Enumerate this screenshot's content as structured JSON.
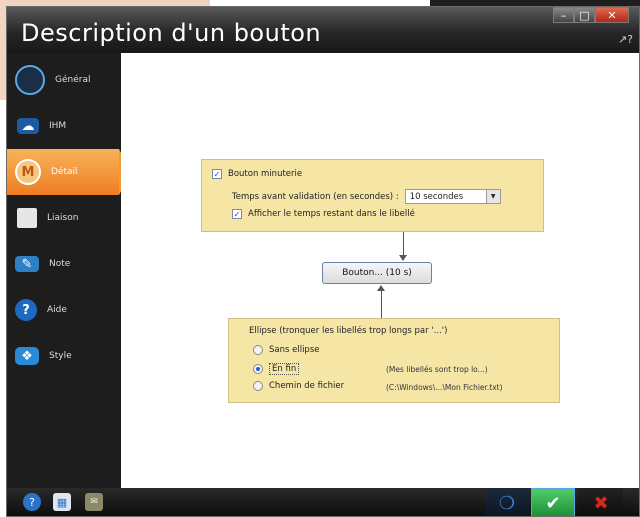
{
  "window": {
    "title": "Description d'un bouton",
    "controls": [
      "minimize-icon",
      "maximize-icon",
      "close-icon"
    ]
  },
  "sidebar": {
    "items": [
      {
        "label": "Général",
        "icon": "general-icon",
        "active": false
      },
      {
        "label": "IHM",
        "icon": "ihm-icon",
        "active": false
      },
      {
        "label": "Détail",
        "icon": "detail-icon",
        "active": true
      },
      {
        "label": "Liaison",
        "icon": "liaison-icon",
        "active": false
      },
      {
        "label": "Note",
        "icon": "note-icon",
        "active": false
      },
      {
        "label": "Aide",
        "icon": "help-icon",
        "active": false
      },
      {
        "label": "Style",
        "icon": "style-icon",
        "active": false
      }
    ]
  },
  "timer_panel": {
    "timer_checkbox": {
      "label": "Bouton minuterie",
      "checked": true
    },
    "delay_label": "Temps avant validation (en secondes) :",
    "delay_value": "10 secondes",
    "show_remaining": {
      "label": "Afficher le temps restant dans le libellé",
      "checked": true
    }
  },
  "preview_button": {
    "label": "Bouton... (10 s)"
  },
  "ellipsis_panel": {
    "title": "Ellipse (tronquer les libellés trop longs par '...')",
    "options": [
      {
        "label": "Sans ellipse",
        "example": "",
        "selected": false
      },
      {
        "label": "En fin",
        "example": "(Mes libellés sont trop lo...)",
        "selected": true
      },
      {
        "label": "Chemin de fichier",
        "example": "(C:\\Windows\\...\\Mon Fichier.txt)",
        "selected": false
      }
    ]
  },
  "footer": {
    "icons": [
      "help-icon",
      "image-icon",
      "note-icon"
    ],
    "buttons": [
      "chevron-down-icon",
      "validate-icon",
      "cancel-icon"
    ]
  },
  "colors": {
    "accent": "#f28c2b",
    "panel": "#f5e6a6",
    "ok": "#2ea84a",
    "cancel": "#d9281a"
  }
}
